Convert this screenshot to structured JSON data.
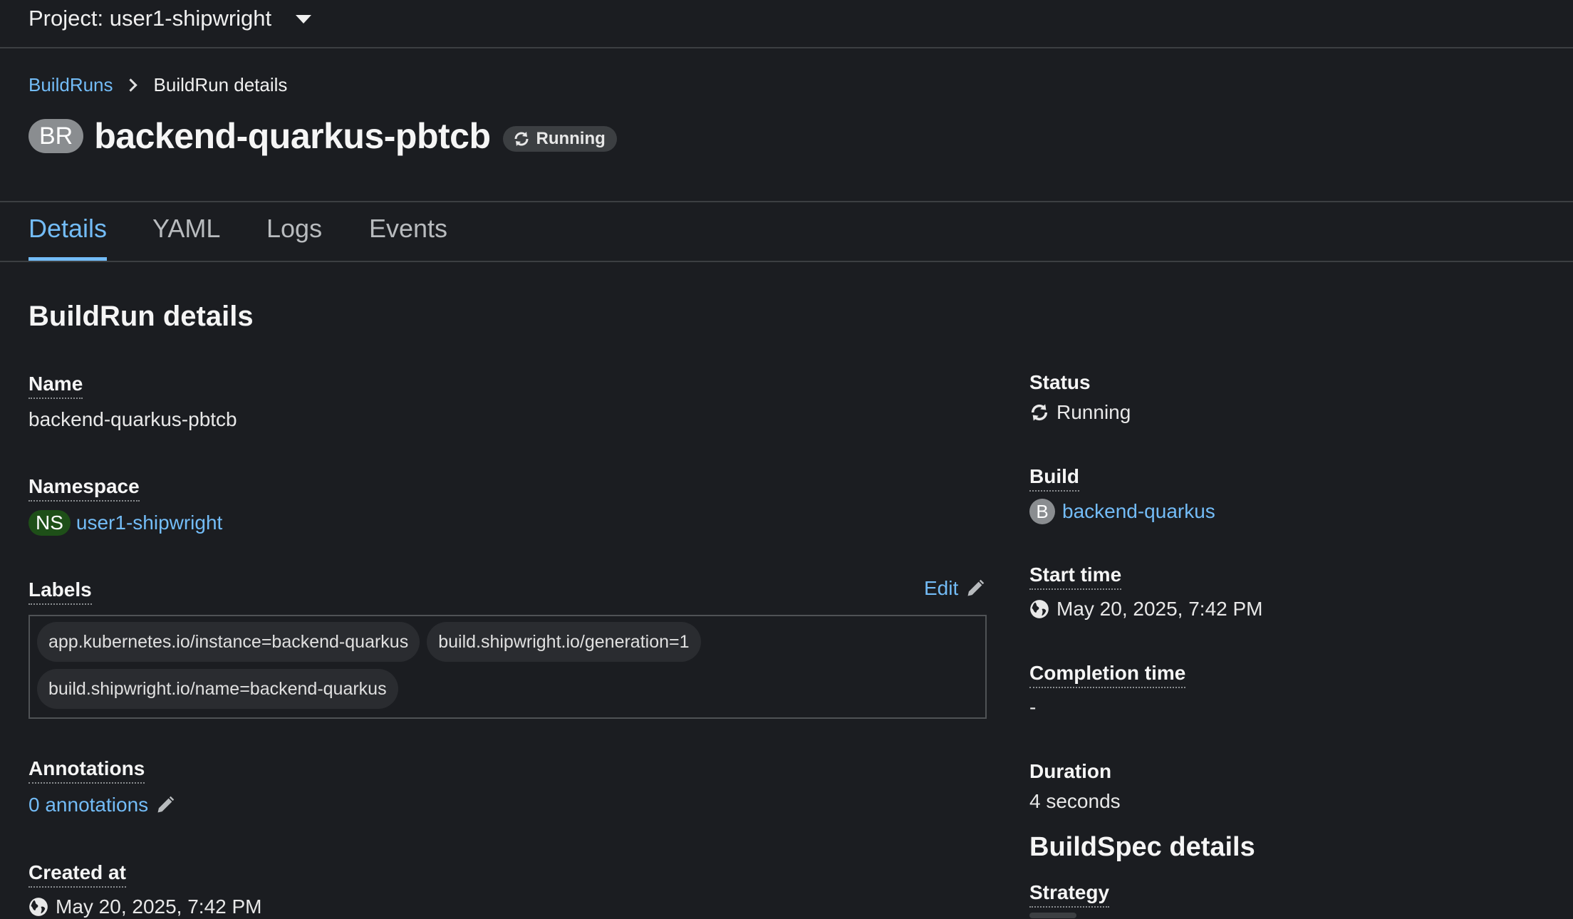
{
  "project": {
    "label": "Project: user1-shipwright"
  },
  "breadcrumb": {
    "parent": "BuildRuns",
    "current": "BuildRun details"
  },
  "resource": {
    "badge": "BR",
    "name": "backend-quarkus-pbtcb",
    "status": "Running"
  },
  "tabs": [
    {
      "label": "Details",
      "active": true
    },
    {
      "label": "YAML",
      "active": false
    },
    {
      "label": "Logs",
      "active": false
    },
    {
      "label": "Events",
      "active": false
    }
  ],
  "details": {
    "section_title": "BuildRun details",
    "name": {
      "label": "Name",
      "value": "backend-quarkus-pbtcb"
    },
    "namespace": {
      "label": "Namespace",
      "badge": "NS",
      "value": "user1-shipwright"
    },
    "labels": {
      "label": "Labels",
      "edit": "Edit",
      "items": [
        "app.kubernetes.io/instance=backend-quarkus",
        "build.shipwright.io/generation=1",
        "build.shipwright.io/name=backend-quarkus"
      ]
    },
    "annotations": {
      "label": "Annotations",
      "value": "0 annotations"
    },
    "created_at": {
      "label": "Created at",
      "value": "May 20, 2025, 7:42 PM"
    }
  },
  "side": {
    "status": {
      "label": "Status",
      "value": "Running"
    },
    "build": {
      "label": "Build",
      "badge": "B",
      "value": "backend-quarkus"
    },
    "start_time": {
      "label": "Start time",
      "value": "May 20, 2025, 7:42 PM"
    },
    "completion_time": {
      "label": "Completion time",
      "value": "-"
    },
    "duration": {
      "label": "Duration",
      "value": "4 seconds"
    },
    "buildspec_title": "BuildSpec details",
    "strategy": {
      "label": "Strategy"
    }
  },
  "colors": {
    "accent": "#73bcf7",
    "background": "#1b1d21",
    "ns_badge": "#1e4f18"
  },
  "icons": [
    "caret-down-icon",
    "chevron-right-icon",
    "sync-icon",
    "globe-icon",
    "pencil-icon"
  ]
}
